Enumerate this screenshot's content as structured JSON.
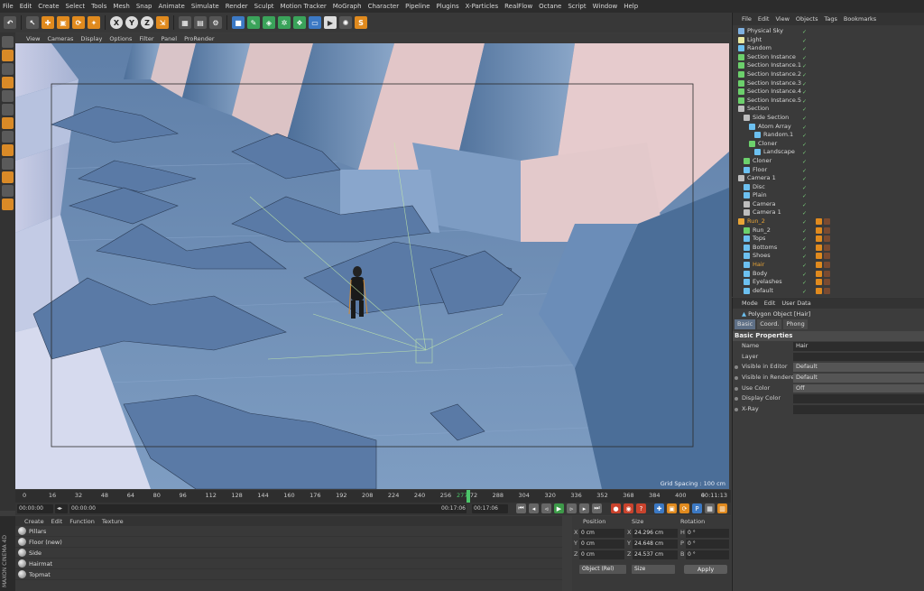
{
  "menubar": [
    "File",
    "Edit",
    "Create",
    "Select",
    "Tools",
    "Mesh",
    "Snap",
    "Animate",
    "Simulate",
    "Render",
    "Sculpt",
    "Motion Tracker",
    "MoGraph",
    "Character",
    "Pipeline",
    "Plugins",
    "X-Particles",
    "RealFlow",
    "Octane",
    "Script",
    "Window",
    "Help"
  ],
  "viewport": {
    "menu": [
      "View",
      "Cameras",
      "Display",
      "Options",
      "Filter",
      "Panel",
      "ProRender"
    ],
    "grid_spacing": "Grid Spacing : 100 cm"
  },
  "timeline": {
    "ticks": [
      "0",
      "16",
      "32",
      "48",
      "64",
      "80",
      "96",
      "112",
      "128",
      "144",
      "160",
      "176",
      "192",
      "208",
      "224",
      "240",
      "256",
      "272",
      "288",
      "304",
      "320",
      "336",
      "352",
      "368",
      "384",
      "400",
      "4"
    ],
    "current_frame": "277",
    "end_frame": "00:11:13"
  },
  "transport": {
    "start": "00:00:00",
    "range_start": "00:00:00",
    "range_end": "00:17:06",
    "current": "00:17:06"
  },
  "materials": {
    "menu": [
      "Create",
      "Edit",
      "Function",
      "Texture"
    ],
    "items": [
      "Pillars",
      "Floor (new)",
      "Side",
      "Hairmat",
      "Topmat"
    ]
  },
  "coordinates": {
    "headers": [
      "Position",
      "Size",
      "Rotation"
    ],
    "rows": [
      {
        "axis": "X",
        "pos": "0 cm",
        "sax": "X",
        "size": "24.296 cm",
        "rax": "H",
        "rot": "0 °"
      },
      {
        "axis": "Y",
        "pos": "0 cm",
        "sax": "Y",
        "size": "24.648 cm",
        "rax": "P",
        "rot": "0 °"
      },
      {
        "axis": "Z",
        "pos": "0 cm",
        "sax": "Z",
        "size": "24.537 cm",
        "rax": "B",
        "rot": "0 °"
      }
    ],
    "mode": "Object (Rel)",
    "size_mode": "Size",
    "apply": "Apply"
  },
  "object_manager": {
    "menu": [
      "File",
      "Edit",
      "View",
      "Objects",
      "Tags",
      "Bookmarks"
    ],
    "objects": [
      {
        "name": "Physical Sky",
        "indent": 0,
        "color": "#7fb0e0",
        "sel": false
      },
      {
        "name": "Light",
        "indent": 0,
        "color": "#e8e8a0",
        "sel": false
      },
      {
        "name": "Random",
        "indent": 0,
        "color": "#6cc0f0",
        "sel": false
      },
      {
        "name": "Section Instance",
        "indent": 0,
        "color": "#6cd06c",
        "sel": false
      },
      {
        "name": "Section Instance.1",
        "indent": 0,
        "color": "#6cd06c",
        "sel": false
      },
      {
        "name": "Section Instance.2",
        "indent": 0,
        "color": "#6cd06c",
        "sel": false
      },
      {
        "name": "Section Instance.3",
        "indent": 0,
        "color": "#6cd06c",
        "sel": false
      },
      {
        "name": "Section Instance.4",
        "indent": 0,
        "color": "#6cd06c",
        "sel": false
      },
      {
        "name": "Section Instance.5",
        "indent": 0,
        "color": "#6cd06c",
        "sel": false
      },
      {
        "name": "Section",
        "indent": 0,
        "color": "#bdbdbd",
        "sel": false
      },
      {
        "name": "Side Section",
        "indent": 1,
        "color": "#bdbdbd",
        "sel": false
      },
      {
        "name": "Atom Array",
        "indent": 2,
        "color": "#6cc0f0",
        "sel": false
      },
      {
        "name": "Random.1",
        "indent": 3,
        "color": "#6cc0f0",
        "sel": false
      },
      {
        "name": "Cloner",
        "indent": 2,
        "color": "#6cd06c",
        "sel": false
      },
      {
        "name": "Landscape",
        "indent": 3,
        "color": "#6cc0f0",
        "sel": false
      },
      {
        "name": "Cloner",
        "indent": 1,
        "color": "#6cd06c",
        "sel": false
      },
      {
        "name": "Floor",
        "indent": 1,
        "color": "#6cc0f0",
        "sel": false
      },
      {
        "name": "Camera 1",
        "indent": 0,
        "color": "#bdbdbd",
        "sel": false
      },
      {
        "name": "Disc",
        "indent": 1,
        "color": "#6cc0f0",
        "sel": false
      },
      {
        "name": "Plain",
        "indent": 1,
        "color": "#6cc0f0",
        "sel": false
      },
      {
        "name": "Camera",
        "indent": 1,
        "color": "#bdbdbd",
        "sel": false
      },
      {
        "name": "Camera 1",
        "indent": 1,
        "color": "#bdbdbd",
        "sel": false
      },
      {
        "name": "Run_2",
        "indent": 0,
        "color": "#e8a437",
        "sel": true
      },
      {
        "name": "Run_2",
        "indent": 1,
        "color": "#6cd06c",
        "sel": false
      },
      {
        "name": "Tops",
        "indent": 1,
        "color": "#6cc0f0",
        "sel": false
      },
      {
        "name": "Bottoms",
        "indent": 1,
        "color": "#6cc0f0",
        "sel": false
      },
      {
        "name": "Shoes",
        "indent": 1,
        "color": "#6cc0f0",
        "sel": false
      },
      {
        "name": "Hair",
        "indent": 1,
        "color": "#6cc0f0",
        "sel": true
      },
      {
        "name": "Body",
        "indent": 1,
        "color": "#6cc0f0",
        "sel": false
      },
      {
        "name": "Eyelashes",
        "indent": 1,
        "color": "#6cc0f0",
        "sel": false
      },
      {
        "name": "default",
        "indent": 1,
        "color": "#6cc0f0",
        "sel": false
      }
    ]
  },
  "attributes": {
    "menu": [
      "Mode",
      "Edit",
      "User Data"
    ],
    "title": "Polygon Object [Hair]",
    "tabs": [
      "Basic",
      "Coord.",
      "Phong"
    ],
    "section": "Basic Properties",
    "rows": [
      {
        "label": "Name",
        "value": "Hair",
        "bullet": false
      },
      {
        "label": "Layer",
        "value": "",
        "bullet": false
      },
      {
        "label": "Visible in Editor",
        "value": "Default",
        "bullet": true
      },
      {
        "label": "Visible in Renderer",
        "value": "Default",
        "bullet": true
      },
      {
        "label": "Use Color",
        "value": "Off",
        "bullet": true
      },
      {
        "label": "Display Color",
        "value": "",
        "bullet": true
      },
      {
        "label": "X-Ray",
        "value": "",
        "bullet": true
      }
    ]
  },
  "side_label": "MAXON CINEMA 4D"
}
